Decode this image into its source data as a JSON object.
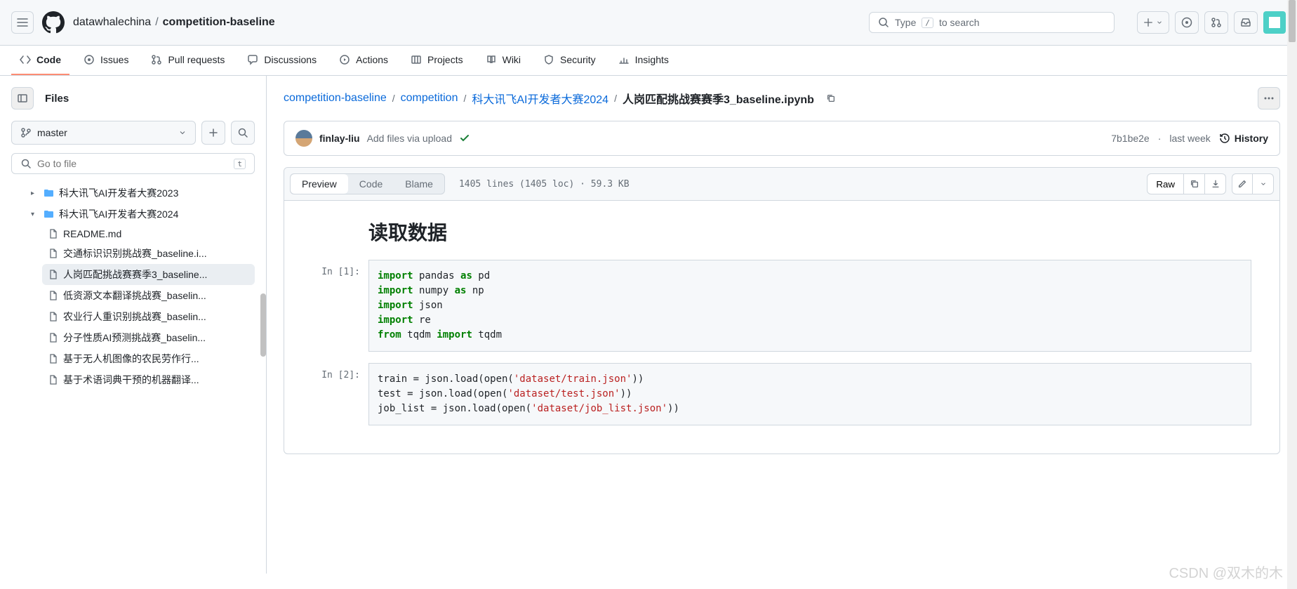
{
  "header": {
    "owner": "datawhalechina",
    "repo": "competition-baseline",
    "search_placeholder_pre": "Type",
    "search_key": "/",
    "search_placeholder_post": "to search"
  },
  "nav": [
    {
      "icon": "code",
      "label": "Code",
      "active": true
    },
    {
      "icon": "issues",
      "label": "Issues"
    },
    {
      "icon": "pr",
      "label": "Pull requests"
    },
    {
      "icon": "discussions",
      "label": "Discussions"
    },
    {
      "icon": "actions",
      "label": "Actions"
    },
    {
      "icon": "projects",
      "label": "Projects"
    },
    {
      "icon": "wiki",
      "label": "Wiki"
    },
    {
      "icon": "security",
      "label": "Security"
    },
    {
      "icon": "insights",
      "label": "Insights"
    }
  ],
  "sidebar": {
    "title": "Files",
    "branch": "master",
    "filter_placeholder": "Go to file",
    "filter_key": "t",
    "tree": [
      {
        "type": "folder",
        "name": "科大讯飞AI开发者大赛2023",
        "expanded": false,
        "level": 1
      },
      {
        "type": "folder",
        "name": "科大讯飞AI开发者大赛2024",
        "expanded": true,
        "level": 1
      },
      {
        "type": "file",
        "name": "README.md",
        "level": 2
      },
      {
        "type": "file",
        "name": "交通标识识别挑战赛_baseline.i...",
        "level": 2
      },
      {
        "type": "file",
        "name": "人岗匹配挑战赛赛季3_baseline...",
        "level": 2,
        "selected": true
      },
      {
        "type": "file",
        "name": "低资源文本翻译挑战赛_baselin...",
        "level": 2
      },
      {
        "type": "file",
        "name": "农业行人重识别挑战赛_baselin...",
        "level": 2
      },
      {
        "type": "file",
        "name": "分子性质AI预测挑战赛_baselin...",
        "level": 2
      },
      {
        "type": "file",
        "name": "基于无人机图像的农民劳作行...",
        "level": 2
      },
      {
        "type": "file",
        "name": "基于术语词典干预的机器翻译...",
        "level": 2
      }
    ]
  },
  "path": {
    "crumbs": [
      "competition-baseline",
      "competition",
      "科大讯飞AI开发者大赛2024"
    ],
    "current": "人岗匹配挑战赛赛季3_baseline.ipynb"
  },
  "commit": {
    "author": "finlay-liu",
    "message": "Add files via upload",
    "sha": "7b1be2e",
    "when": "last week",
    "history": "History"
  },
  "file": {
    "tabs": {
      "preview": "Preview",
      "code": "Code",
      "blame": "Blame"
    },
    "meta": "1405 lines (1405 loc) · 59.3 KB",
    "raw": "Raw"
  },
  "notebook": {
    "heading": "读取数据",
    "cells": [
      {
        "prompt": "In [1]:",
        "lines": [
          {
            "t": [
              [
                "kw",
                "import"
              ],
              [
                "",
                " pandas "
              ],
              [
                "kw",
                "as"
              ],
              [
                "",
                " pd"
              ]
            ]
          },
          {
            "t": [
              [
                "kw",
                "import"
              ],
              [
                "",
                " numpy "
              ],
              [
                "kw",
                "as"
              ],
              [
                "",
                " np"
              ]
            ]
          },
          {
            "t": [
              [
                "kw",
                "import"
              ],
              [
                "",
                " json"
              ]
            ]
          },
          {
            "t": [
              [
                "kw",
                "import"
              ],
              [
                "",
                " re"
              ]
            ]
          },
          {
            "t": [
              [
                "kw",
                "from"
              ],
              [
                "",
                " tqdm "
              ],
              [
                "kw",
                "import"
              ],
              [
                "",
                " tqdm"
              ]
            ]
          }
        ]
      },
      {
        "prompt": "In [2]:",
        "lines": [
          {
            "t": [
              [
                "",
                "train = json.load(open("
              ],
              [
                "str",
                "'dataset/train.json'"
              ],
              [
                "",
                ")) "
              ]
            ]
          },
          {
            "t": [
              [
                "",
                "test = json.load(open("
              ],
              [
                "str",
                "'dataset/test.json'"
              ],
              [
                "",
                ")) "
              ]
            ]
          },
          {
            "t": [
              [
                "",
                "job_list = json.load(open("
              ],
              [
                "str",
                "'dataset/job_list.json'"
              ],
              [
                "",
                ")) "
              ]
            ]
          }
        ]
      }
    ]
  },
  "watermark": "CSDN @双木的木"
}
